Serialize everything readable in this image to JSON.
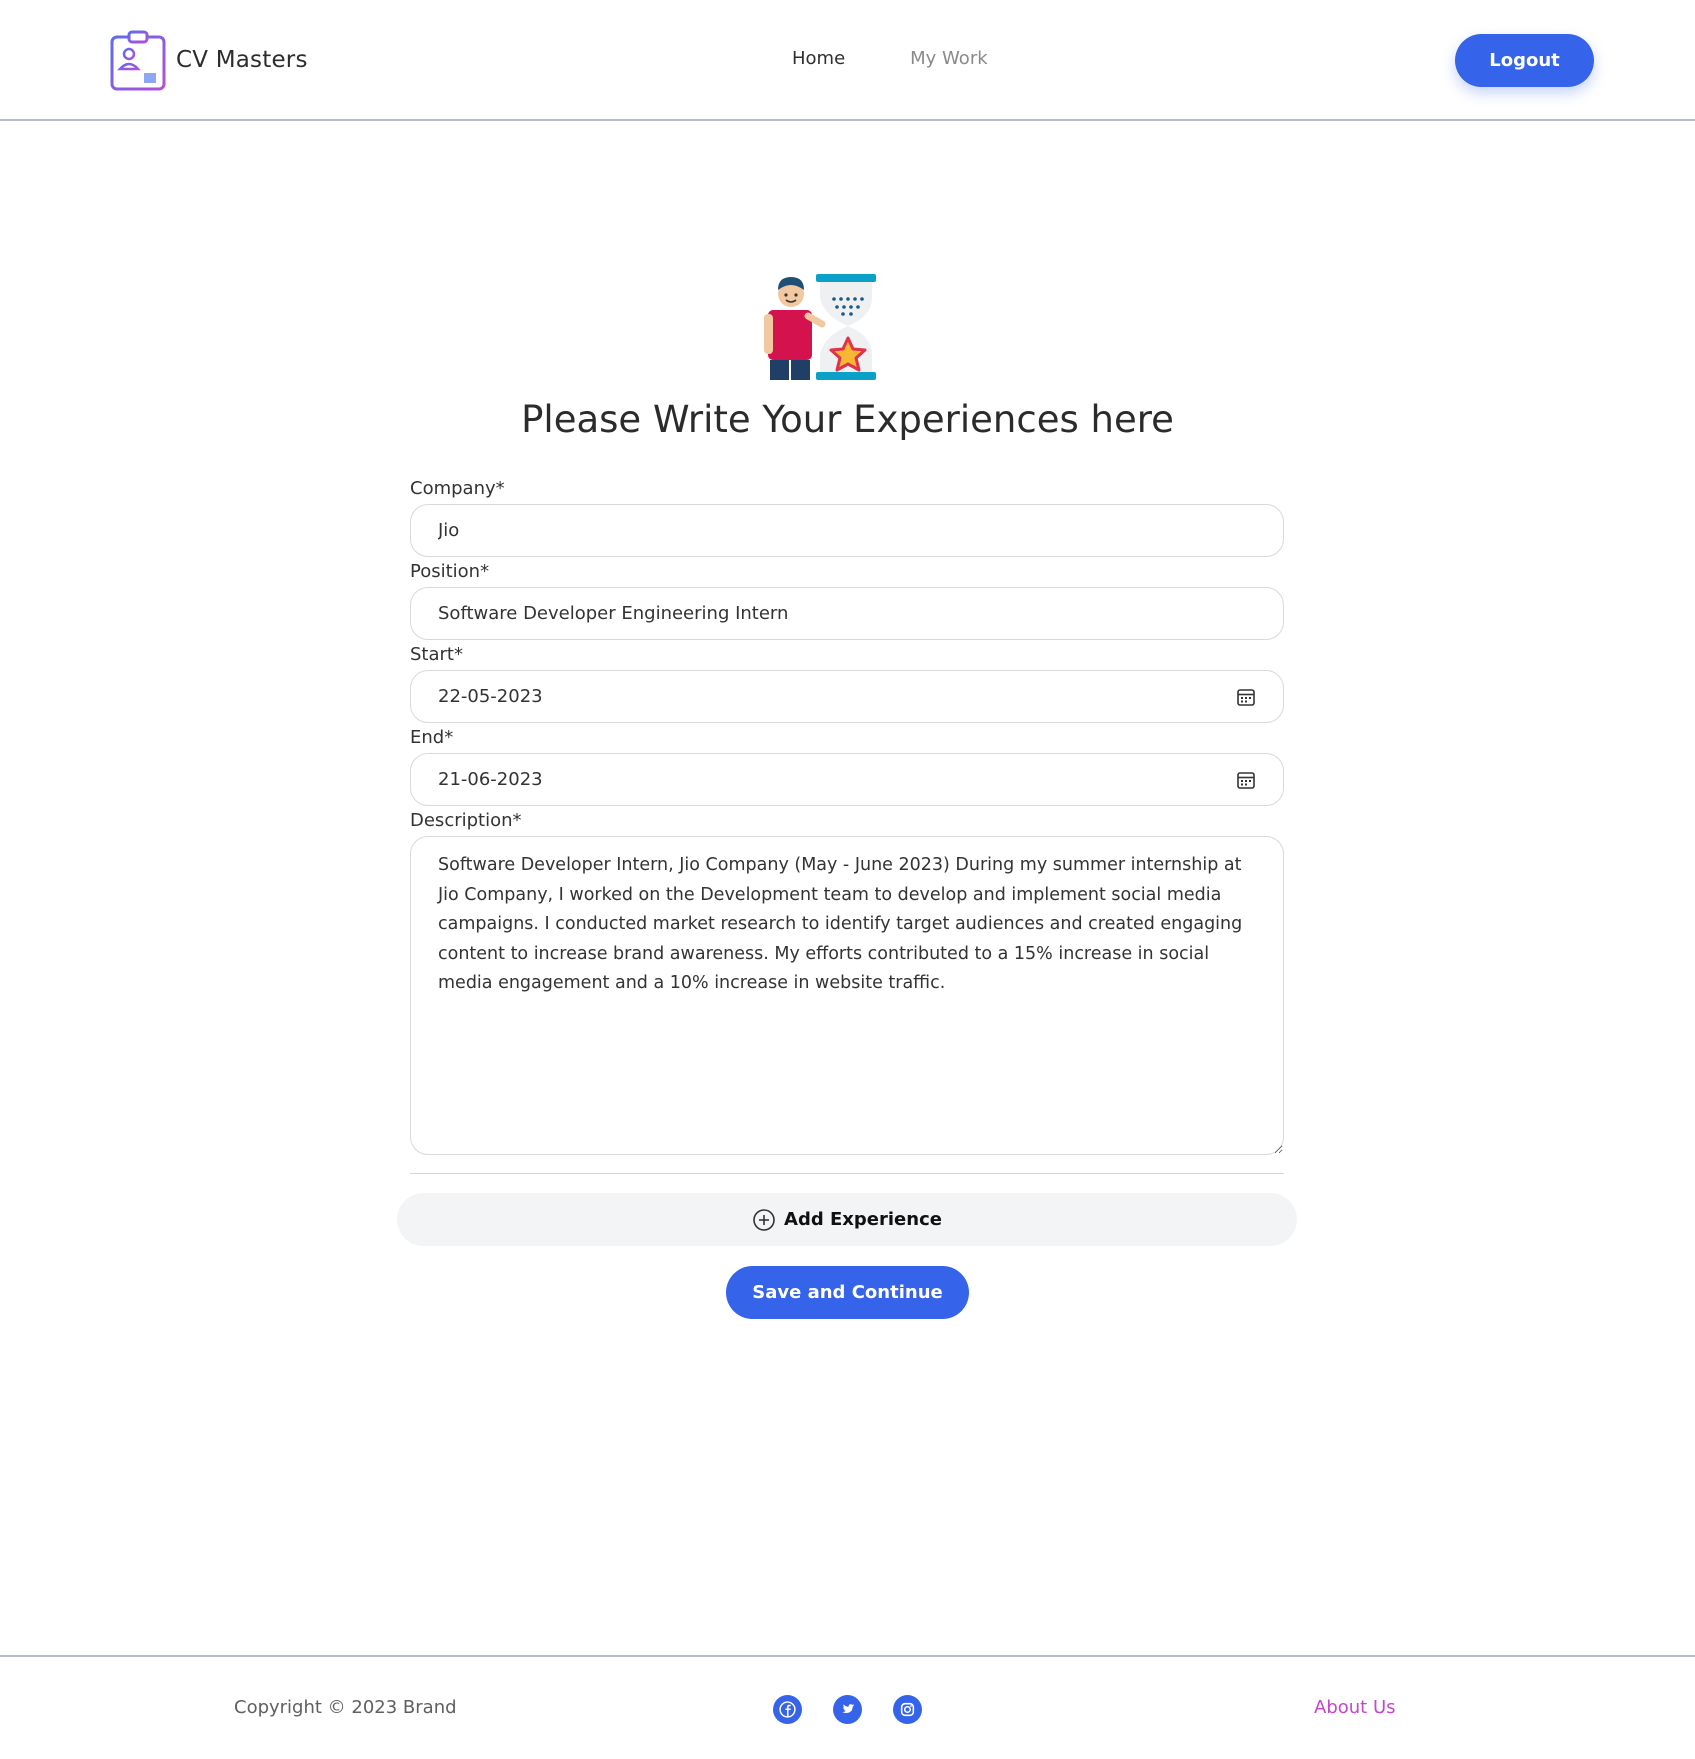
{
  "header": {
    "brand_name": "CV Masters",
    "nav": {
      "home": "Home",
      "my_work": "My Work"
    },
    "logout_label": "Logout"
  },
  "main": {
    "title": "Please Write Your Experiences here",
    "form": {
      "company": {
        "label": "Company*",
        "value": "Jio"
      },
      "position": {
        "label": "Position*",
        "value": "Software Developer Engineering Intern"
      },
      "start": {
        "label": "Start*",
        "value": "22-05-2023"
      },
      "end": {
        "label": "End*",
        "value": "21-06-2023"
      },
      "description": {
        "label": "Description*",
        "value": "Software Developer Intern, Jio Company (May - June 2023) During my summer internship at Jio Company, I worked on the Development team to develop and implement social media campaigns. I conducted market research to identify target audiences and created engaging content to increase brand awareness. My efforts contributed to a 15% increase in social media engagement and a 10% increase in website traffic."
      }
    },
    "add_experience_label": "Add Experience",
    "save_label": "Save and Continue"
  },
  "footer": {
    "copyright": "Copyright © 2023 Brand",
    "socials": [
      "facebook-icon",
      "twitter-icon",
      "instagram-icon"
    ],
    "about_label": "About Us"
  },
  "colors": {
    "primary": "#3563e9",
    "about_link": "#c248c8",
    "divider": "#aebfd3"
  }
}
